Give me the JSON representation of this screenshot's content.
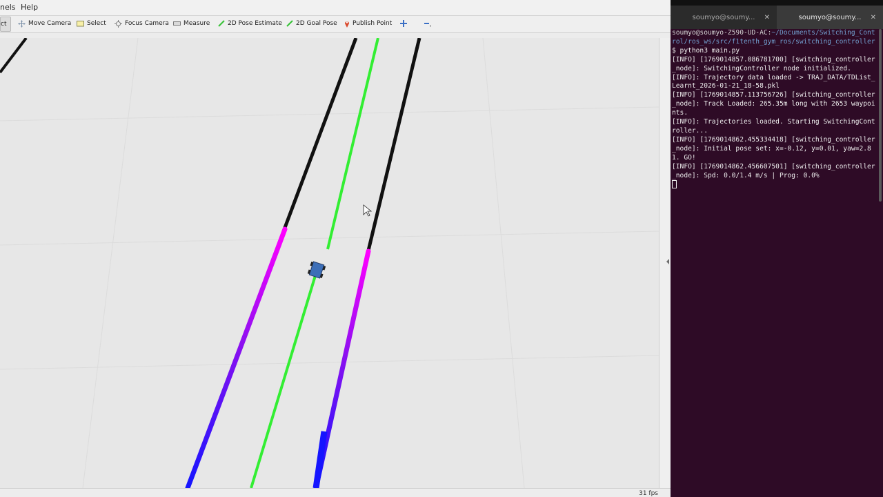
{
  "rviz": {
    "menu": {
      "panels": "nels",
      "help": "Help"
    },
    "toolbar": {
      "interact": "ct",
      "move_camera": "Move Camera",
      "select": "Select",
      "focus_camera": "Focus Camera",
      "measure": "Measure",
      "pose_estimate": "2D Pose Estimate",
      "goal_pose": "2D Goal Pose",
      "publish_point": "Publish Point"
    },
    "status": {
      "fps": "31 fps"
    }
  },
  "terminal": {
    "tabs": [
      "soumyo@soumy...",
      "soumyo@soumy..."
    ],
    "prompt_user": "soumyo@soumyo-Z590-UD-AC:",
    "prompt_path": "~/Documents/Switching_Control/ros_ws/src/f1tenth_gym_ros/switching_controller",
    "command": "$ python3 main.py",
    "log_lines": [
      "[INFO] [1769014857.086781700] [switching_controller_node]: SwitchingController node initialized.",
      "[INFO]: Trajectory data loaded -> TRAJ_DATA/TDList_Learnt_2026-01-21_18-58.pkl",
      "[INFO] [1769014857.113756726] [switching_controller_node]: Track Loaded: 265.35m long with 2653 waypoints.",
      "[INFO]: Trajectories loaded. Starting SwitchingController...",
      "[INFO] [1769014862.455334418] [switching_controller_node]: Initial pose set: x=-0.12, y=0.01, yaw=2.81. GO!",
      "[INFO] [1769014862.456607501] [switching_controller_node]: Spd: 0.0/1.4 m/s | Prog: 0.0%"
    ]
  },
  "colors": {
    "track_boundary": "#111111",
    "raceline": "#33ee33",
    "marker_magenta": "#ff00ff",
    "marker_blue": "#2222ff",
    "vehicle": "#3d6fb8",
    "terminal_bg": "#2e0b26"
  }
}
